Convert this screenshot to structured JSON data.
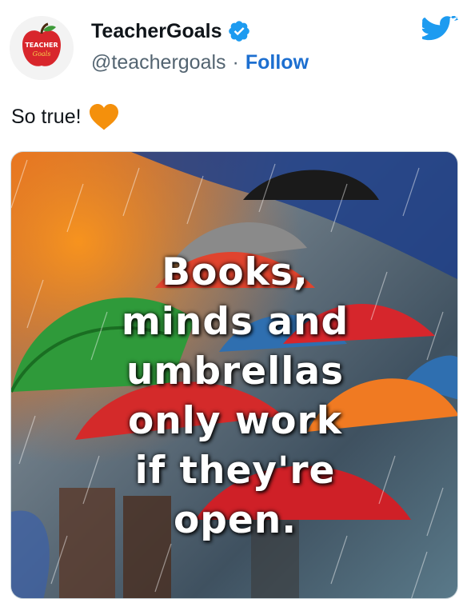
{
  "account": {
    "display_name": "TeacherGoals",
    "handle": "@teachergoals",
    "separator": "·",
    "follow_label": "Follow",
    "avatar_text_top": "TEACHER",
    "avatar_text_bottom": "Goals"
  },
  "tweet": {
    "text": "So true!",
    "emoji": "orange-heart"
  },
  "media": {
    "lines": [
      "Books,",
      "minds and",
      "umbrellas",
      "only work",
      "if they're",
      "open."
    ]
  },
  "icons": {
    "verified": "verified-badge-icon",
    "platform": "twitter-bird-icon"
  },
  "colors": {
    "accent_blue": "#1d9bf0",
    "follow_blue": "#1d6fd0",
    "heart_orange": "#f4900c"
  }
}
